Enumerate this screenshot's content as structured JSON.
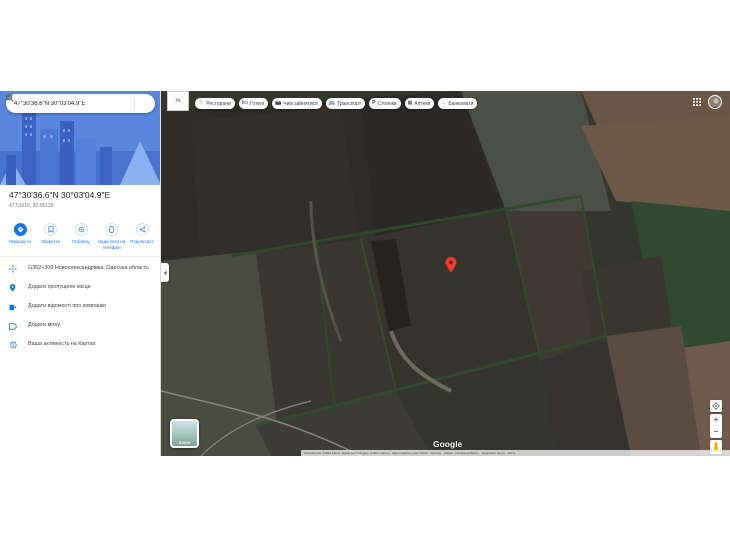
{
  "search": {
    "query": "47°30'36.6\"N 30°03'04.9\"E"
  },
  "place": {
    "title": "47°30'36.6\"N 30°03'04.9\"E",
    "subtitle": "47.51016, 30.05139"
  },
  "actions": [
    {
      "label": "Маршрути",
      "icon": "directions-icon"
    },
    {
      "label": "Зберегти",
      "icon": "bookmark-icon"
    },
    {
      "label": "Поблизу",
      "icon": "nearby-icon"
    },
    {
      "label": "Надіслати на телефон",
      "icon": "send-to-phone-icon"
    },
    {
      "label": "Поділитися",
      "icon": "share-icon"
    }
  ],
  "info": [
    {
      "text": "G362+309 Новоолександрівка, Одеська область",
      "icon": "plus-code-icon"
    },
    {
      "text": "Додати пропущене місце",
      "icon": "add-place-icon"
    },
    {
      "text": "Додати відомості про компанію",
      "icon": "business-icon"
    },
    {
      "text": "Додати мітку",
      "icon": "label-icon"
    },
    {
      "text": "Ваша активність на Картах",
      "icon": "history-icon"
    }
  ],
  "map": {
    "language": "Ук",
    "chips": [
      {
        "label": "Ресторани",
        "icon": "restaurant-icon"
      },
      {
        "label": "Готелі",
        "icon": "hotel-icon"
      },
      {
        "label": "Чим зайнятися",
        "icon": "camera-icon"
      },
      {
        "label": "Транспорт",
        "icon": "transit-icon"
      },
      {
        "label": "Стоянки",
        "icon": "parking-icon"
      },
      {
        "label": "Аптеки",
        "icon": "pharmacy-icon"
      },
      {
        "label": "Банкомати",
        "icon": "atm-icon"
      }
    ],
    "layers_label": "Шари",
    "logo": "Google",
    "attribution": "Зображення ©2023 Airbus, Maxar Technologies, CNES / Airbus · Картографічні дані ©2023 · Україна · Умови · Конфіденційність · Надіслати відгук · 100 м",
    "colors": {
      "pin": "#ea4335",
      "accent": "#1a73e8"
    }
  }
}
